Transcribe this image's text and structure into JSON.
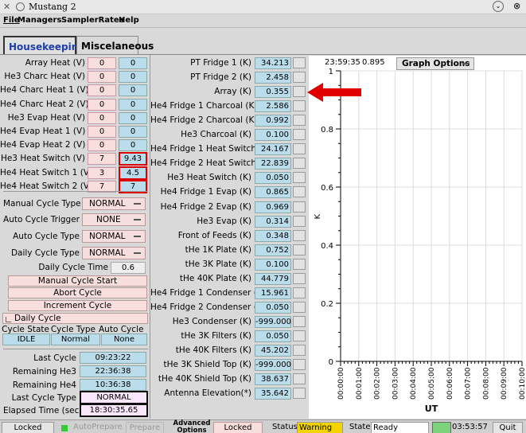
{
  "window": {
    "title": "Mustang 2",
    "close": "⊗",
    "min": "⌄"
  },
  "menu": [
    "File",
    "Managers",
    "SamplerRates",
    "Help"
  ],
  "tabs": [
    "Housekeeping",
    "Miscelaneous"
  ],
  "heaters": [
    {
      "label": "Array Heat (V)",
      "v1": "0",
      "v2": "0",
      "hi": false
    },
    {
      "label": "He3 Charc Heat (V)",
      "v1": "0",
      "v2": "0",
      "hi": false
    },
    {
      "label": "He4 Charc Heat 1 (V)",
      "v1": "0",
      "v2": "0",
      "hi": false
    },
    {
      "label": "He4 Charc Heat 2 (V)",
      "v1": "0",
      "v2": "0",
      "hi": false
    },
    {
      "label": "He3 Evap Heat (V)",
      "v1": "0",
      "v2": "0",
      "hi": false
    },
    {
      "label": "He4 Evap Heat 1 (V)",
      "v1": "0",
      "v2": "0",
      "hi": false
    },
    {
      "label": "He4 Evap Heat 2 (V)",
      "v1": "0",
      "v2": "0",
      "hi": false
    },
    {
      "label": "He3 Heat Switch (V)",
      "v1": "7",
      "v2": "9.43",
      "hi": true
    },
    {
      "label": "He4 Heat Switch 1 (V)",
      "v1": "3",
      "v2": "4.5",
      "hi": true
    },
    {
      "label": "He4 Heat Switch 2 (V)",
      "v1": "7",
      "v2": "7",
      "hi": true
    }
  ],
  "cycle": {
    "manual_type_label": "Manual Cycle Type",
    "manual_type": "NORMAL",
    "auto_trigger_label": "Auto Cycle Trigger",
    "auto_trigger": "NONE",
    "auto_type_label": "Auto Cycle Type",
    "auto_type": "NORMAL",
    "daily_type_label": "Daily Cycle Type",
    "daily_type": "NORMAL",
    "daily_time_label": "Daily Cycle Time",
    "daily_time": "0.6",
    "manual_start": "Manual Cycle Start",
    "abort": "Abort Cycle",
    "increment": "Increment Cycle",
    "daily_check": "Daily Cycle",
    "state_hdr": "Cycle State",
    "type_hdr": "Cycle Type",
    "auto_hdr": "Auto Cycle",
    "state": "IDLE",
    "type": "Normal",
    "auto": "None",
    "last_label": "Last Cycle",
    "last": "09:23:22",
    "rem3_label": "Remaining He3",
    "rem3": "22:36:38",
    "rem4_label": "Remaining He4",
    "rem4": "10:36:38",
    "lasttype_label": "Last Cycle Type",
    "lasttype": "NORMAL",
    "elapsed_label": "Elapsed Time (sec)",
    "elapsed": "18:30:35.65"
  },
  "temps": [
    {
      "label": "PT Fridge 1 (K)",
      "value": "34.213"
    },
    {
      "label": "PT Fridge 2 (K)",
      "value": "2.458"
    },
    {
      "label": "Array (K)",
      "value": "0.355"
    },
    {
      "label": "He4 Fridge 1 Charcoal (K)",
      "value": "2.586"
    },
    {
      "label": "He4 Fridge 2 Charcoal (K)",
      "value": "0.992"
    },
    {
      "label": "He3 Charcoal (K)",
      "value": "0.100"
    },
    {
      "label": "He4 Fridge 1 Heat Switch (K)",
      "value": "24.167"
    },
    {
      "label": "He4 Fridge 2 Heat Switch (K)",
      "value": "22.839"
    },
    {
      "label": "He3 Heat Switch (K)",
      "value": "0.050"
    },
    {
      "label": "He4 Fridge 1 Evap (K)",
      "value": "0.865"
    },
    {
      "label": "He4 Fridge 2 Evap (K)",
      "value": "0.969"
    },
    {
      "label": "He3 Evap (K)",
      "value": "0.314"
    },
    {
      "label": "Front of Feeds (K)",
      "value": "0.348"
    },
    {
      "label": "tHe 1K Plate (K)",
      "value": "0.752"
    },
    {
      "label": "tHe 3K Plate (K)",
      "value": "0.100"
    },
    {
      "label": "tHe 40K Plate (K)",
      "value": "44.779"
    },
    {
      "label": "He4 Fridge 1 Condenser (K)",
      "value": "15.961"
    },
    {
      "label": "He4 Fridge 2 Condenser (K)",
      "value": "0.050"
    },
    {
      "label": "He3 Condenser (K)",
      "value": "-999.000"
    },
    {
      "label": "tHe 3K Filters (K)",
      "value": "0.050"
    },
    {
      "label": "tHe 40K Filters (K)",
      "value": "45.202"
    },
    {
      "label": "tHe 3K Shield Top (K)",
      "value": "-999.000"
    },
    {
      "label": "tHe 40K Shield Top (K)",
      "value": "38.637"
    },
    {
      "label": "Antenna Elevation(*)",
      "value": "35.642"
    }
  ],
  "plot": {
    "time": "23:59:35",
    "value": "0.895",
    "options": "Graph Options",
    "ylabel": "K",
    "xlabel": "UT",
    "yticks": [
      "1",
      "0.8",
      "0.6",
      "0.4",
      "0.2",
      "0"
    ],
    "xticks": [
      "00:00:00",
      "00:01:00",
      "00:02:00",
      "00:03:00",
      "00:04:00",
      "00:05:00",
      "00:06:00",
      "00:07:00",
      "00:08:00",
      "00:09:00",
      "00:10:00"
    ]
  },
  "status": {
    "locked": "Locked",
    "autoprepare": "AutoPrepare",
    "prepare": "Prepare",
    "advanced": "Advanced",
    "advanced2": "Options",
    "locked2": "Locked",
    "status_label": "Status",
    "status_value": "Warning",
    "state_label": "State",
    "state_value": "Ready",
    "time": "03:53:57",
    "quit": "Quit"
  },
  "colors": {
    "value_bg": "#bbdcea",
    "pink": "#f9dede",
    "arrow": "#e00000",
    "warning": "#f3d400",
    "tab_active": "#1d3fa8"
  }
}
